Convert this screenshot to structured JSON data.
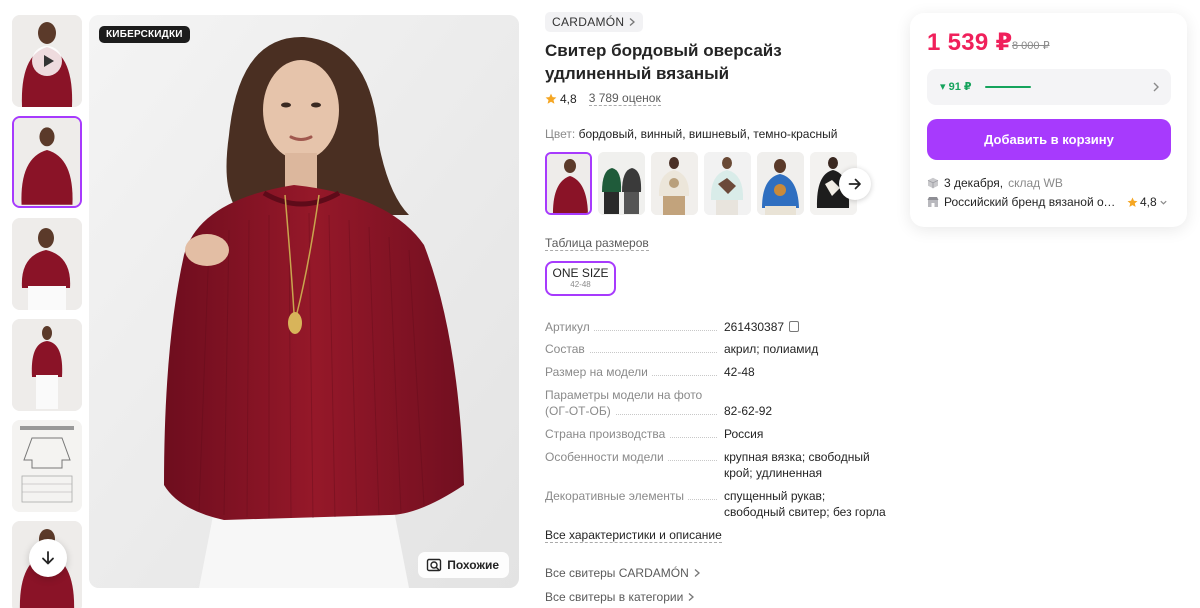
{
  "gallery": {
    "badge": "КИБЕРСКИДКИ",
    "similar_label": "Похожие"
  },
  "product": {
    "brand": "CARDAMÓN",
    "title": "Свитер бордовый оверсайз удлиненный вязаный",
    "rating": "4,8",
    "reviews": "3 789 оценок",
    "color_label": "Цвет:",
    "color_value": "бордовый, винный, вишневый, темно-красный",
    "size_table_link": "Таблица размеров",
    "size_name": "ONE SIZE",
    "size_range": "42-48"
  },
  "specs": [
    {
      "key": "Артикул",
      "value": "261430387"
    },
    {
      "key": "Состав",
      "value": "акрил; полиамид"
    },
    {
      "key": "Размер на модели",
      "value": "42-48"
    },
    {
      "key": "Параметры модели на фото (ОГ-ОТ-ОБ)",
      "value": "82-62-92"
    },
    {
      "key": "Страна производства",
      "value": "Россия"
    },
    {
      "key": "Особенности модели",
      "value": "крупная вязка; свободный крой; удлиненная"
    },
    {
      "key": "Декоративные элементы",
      "value": "спущенный рукав; свободный свитер; без горла"
    }
  ],
  "links": {
    "all_specs": "Все характеристики и описание",
    "all_brand": "Все свитеры CARDAMÓN",
    "all_category": "Все свитеры в категории"
  },
  "buy": {
    "price": "1 539 ₽",
    "old_price": "8 000 ₽",
    "wallet_amount": "▾ 91 ₽",
    "cart_button": "Добавить в корзину",
    "delivery_date": "3 декабря,",
    "warehouse": "склад WB",
    "seller_name": "Российский бренд вязаной одежды CARDAMÓN",
    "seller_rating": "4,8"
  },
  "colors": {
    "accent": "#a73afd",
    "price": "#f0205b",
    "wallet": "#15a35c",
    "sweater": "#8a1327"
  },
  "icons": [
    "play-icon",
    "arrow-down-icon",
    "search-similar-icon",
    "chevron-right-icon",
    "arrow-right-icon",
    "star-icon",
    "copy-icon",
    "box-icon",
    "shop-icon",
    "chevron-down-icon"
  ]
}
